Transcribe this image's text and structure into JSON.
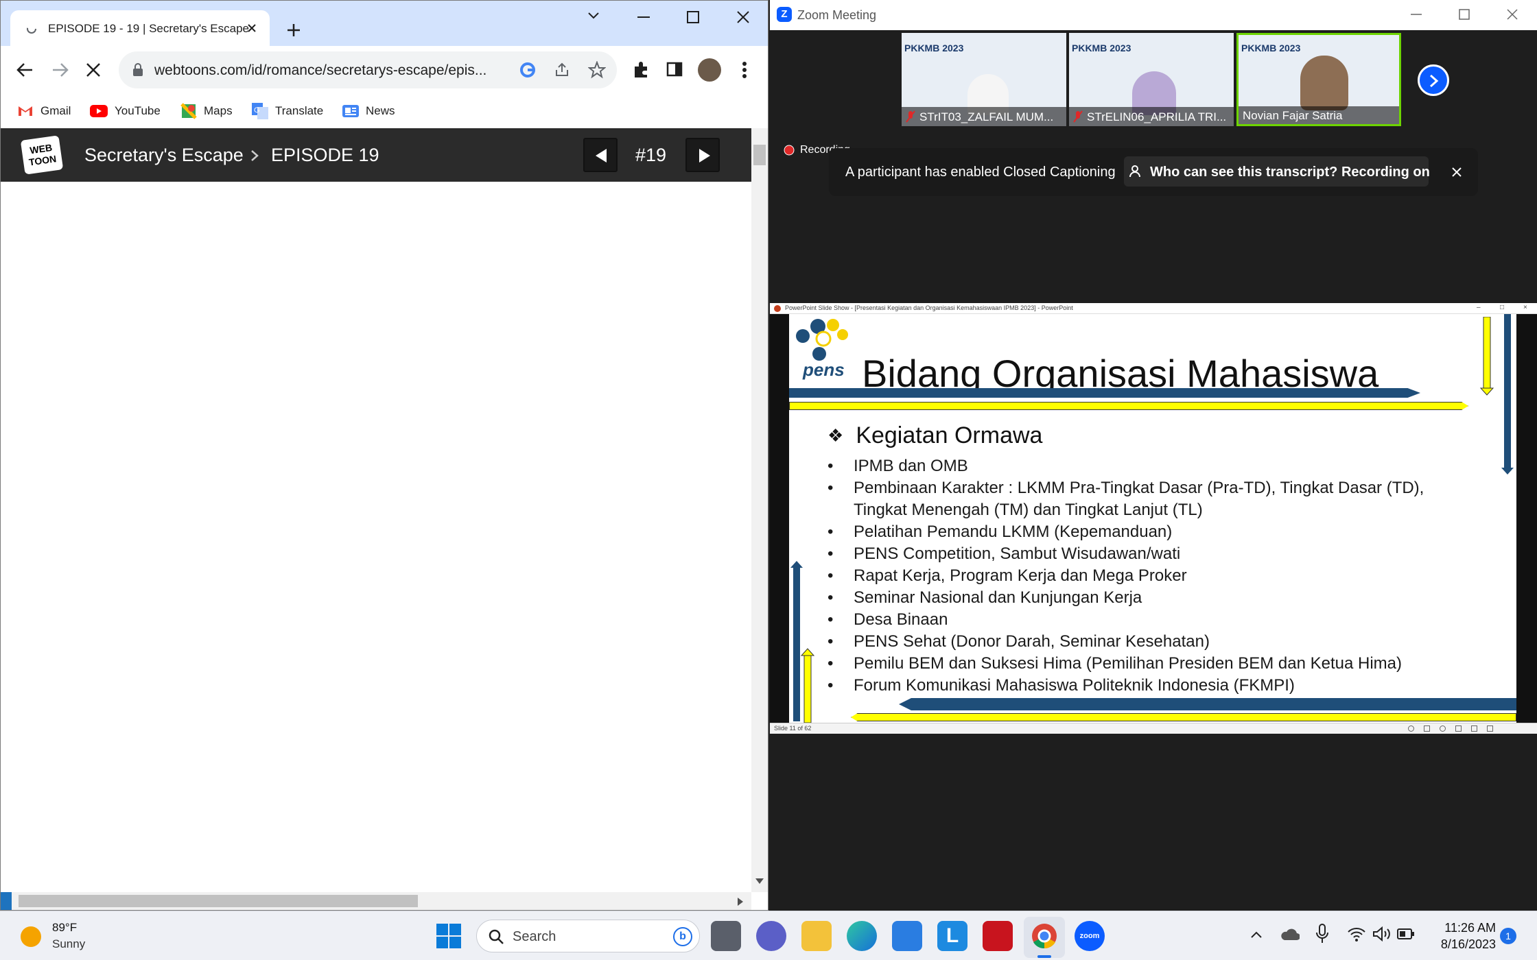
{
  "browser": {
    "tab_title": "EPISODE 19 - 19 | Secretary's Escape",
    "url": "webtoons.com/id/romance/secretarys-escape/epis...",
    "bookmarks": [
      "Gmail",
      "YouTube",
      "Maps",
      "Translate",
      "News"
    ]
  },
  "webtoon": {
    "logo_line1": "WEB",
    "logo_line2": "TOON",
    "series": "Secretary's Escape",
    "episode": "EPISODE 19",
    "number": "#19"
  },
  "zoom": {
    "window_title": "Zoom Meeting",
    "participants": [
      {
        "name": "STrIT03_ZALFAIL MUM...",
        "muted": true
      },
      {
        "name": "STrELIN06_APRILIA TRI...",
        "muted": true
      },
      {
        "name": "Novian Fajar Satria",
        "muted": false
      }
    ],
    "thumb_title": "PKKMB 2023",
    "recording": "Recording",
    "cc_message": "A participant has enabled Closed Captioning",
    "cc_link": "Who can see this transcript? Recording on"
  },
  "ppt": {
    "window_title": "PowerPoint Slide Show - [Presentasi Kegiatan dan Organisasi Kemahasiswaan IPMB 2023] - PowerPoint",
    "logo_text": "pens",
    "title": "Bidang Organisasi Mahasiswa",
    "subtitle": "Kegiatan Ormawa",
    "bullets": [
      "IPMB dan OMB",
      "Pembinaan Karakter : LKMM Pra-Tingkat Dasar (Pra-TD), Tingkat Dasar (TD), Tingkat Menengah (TM) dan Tingkat Lanjut (TL)",
      "Pelatihan Pemandu LKMM (Kepemanduan)",
      "PENS Competition, Sambut Wisudawan/wati",
      "Rapat Kerja, Program Kerja dan Mega Proker",
      "Seminar Nasional dan Kunjungan Kerja",
      "Desa Binaan",
      "PENS Sehat (Donor Darah, Seminar Kesehatan)",
      "Pemilu BEM dan Suksesi Hima (Pemilihan Presiden BEM dan Ketua Hima)",
      "Forum Komunikasi Mahasiswa Politeknik Indonesia (FKMPI)"
    ],
    "status": "Slide 11 of 62"
  },
  "taskbar": {
    "weather_temp": "89°F",
    "weather_desc": "Sunny",
    "search": "Search",
    "zoom_label": "zoom",
    "time": "11:26 AM",
    "date": "8/16/2023",
    "notifications": "1"
  },
  "colors": {
    "chrome_tab_bg": "#d3e3fd",
    "accent_blue": "#0b5cff",
    "slide_navy": "#1f4e79",
    "slide_yellow": "#ffff00"
  }
}
